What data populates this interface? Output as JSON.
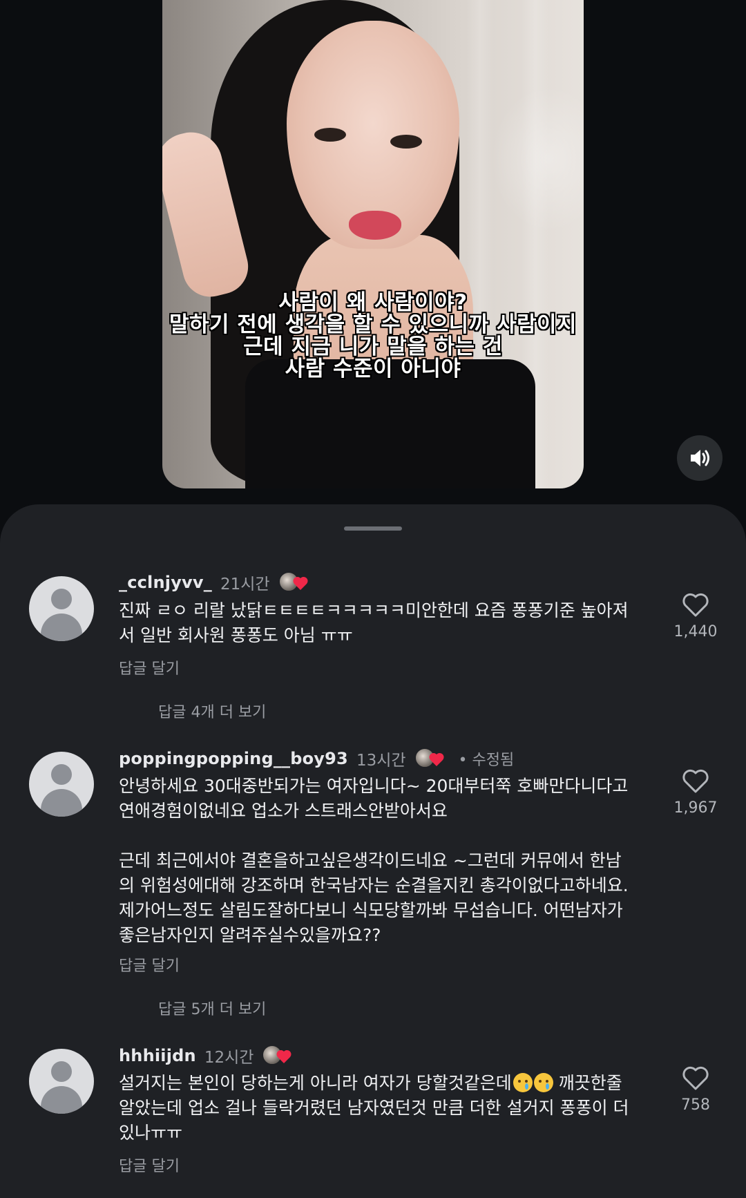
{
  "video": {
    "subtitle_lines": [
      "사람이 왜 사람이야?",
      "말하기 전에 생각을 할 수 있으니까 사람이지",
      "근데 지금 니가 말을 하는 건",
      "사람 수준이 아니야"
    ],
    "sound_icon": "speaker-icon"
  },
  "comments": [
    {
      "username": "_cclnjyvv_",
      "time": "21시간",
      "edited": "",
      "text_paragraphs": [
        "진짜 ㄹㅇ 리랄 났닭ㅌㅌㅌㅌㅋㅋㅋㅋㅋ미안한데 요즘 퐁퐁기준 높아져서 일반 회사원 퐁퐁도 아님 ㅠㅠ"
      ],
      "reply_label": "답글 달기",
      "more_replies": "답글 4개 더 보기",
      "likes": "1,440"
    },
    {
      "username": "poppingpopping__boy93",
      "time": "13시간",
      "edited": "• 수정됨",
      "text_paragraphs": [
        "안녕하세요 30대중반되가는 여자입니다~ 20대부터쭉 호빠만다니다고 연애경험이없네요 업소가 스트래스안받아서요",
        "근데 최근에서야 결혼을하고싶은생각이드네요 ~그런데 커뮤에서 한남의 위험성에대해 강조하며 한국남자는 순결을지킨 총각이없다고하네요. 제가어느정도 살림도잘하다보니 식모당할까봐 무섭습니다. 어떤남자가 좋은남자인지 알려주실수있을까요??"
      ],
      "reply_label": "답글 달기",
      "more_replies": "답글 5개 더 보기",
      "likes": "1,967"
    },
    {
      "username": "hhhiijdn",
      "time": "12시간",
      "edited": "",
      "text_before_emoji": "설거지는 본인이 당하는게 아니라 여자가 당할것같은데",
      "text_after_emoji": " 깨끗한줄 알았는데 업소 걸나 들락거렸던 남자였던것 만큼 더한 설거지 퐁퐁이 더있나ㅠㅠ",
      "emoji": "crying-face-emoji",
      "reply_label": "답글 달기",
      "likes": "758"
    }
  ],
  "colors": {
    "background": "#0b0d10",
    "sheet": "#1f2125",
    "secondary_text": "#9a9da3",
    "creator_heart": "#f02849"
  }
}
